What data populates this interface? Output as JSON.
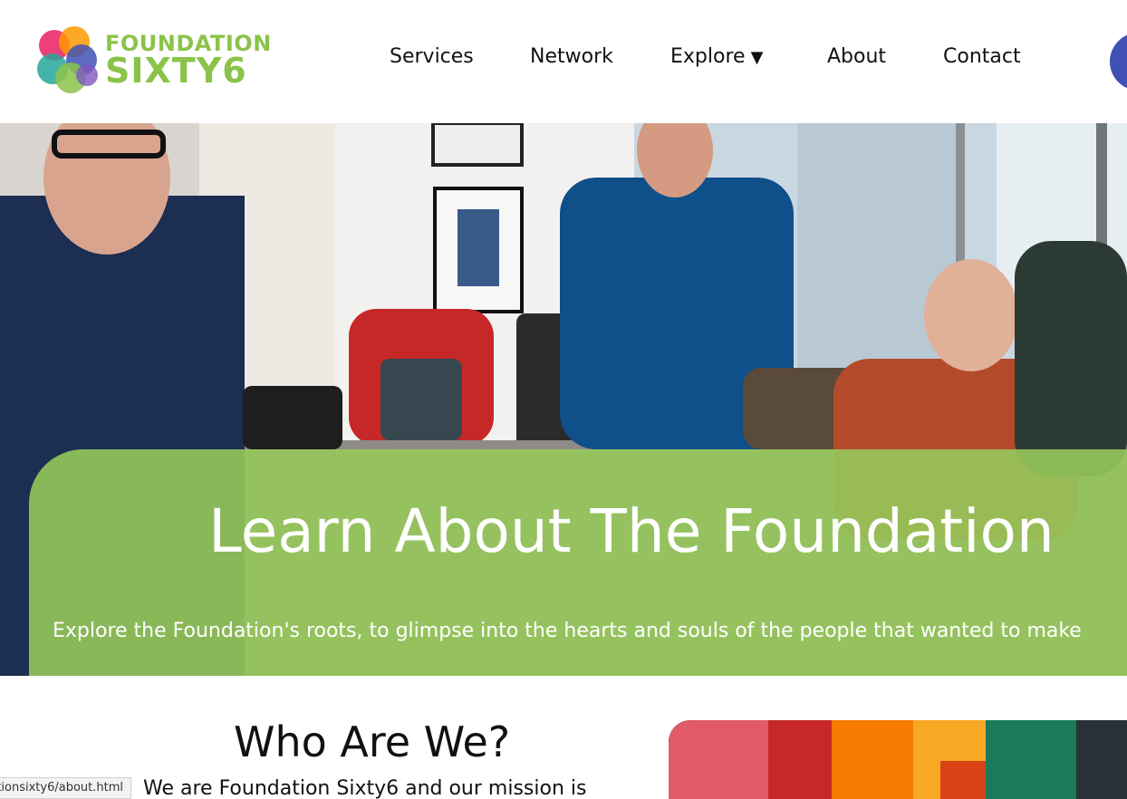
{
  "header": {
    "logo": {
      "line1": "FOUNDATION",
      "line2": "SIXTY6",
      "brand_color": "#8bc34a",
      "icon": "overlapping-circles-logo-icon"
    },
    "nav": [
      {
        "label": "Services"
      },
      {
        "label": "Network"
      },
      {
        "label": "Explore"
      },
      {
        "label": "About"
      },
      {
        "label": "Contact"
      }
    ],
    "dropdown_caret": "▼"
  },
  "hero": {
    "title": "Learn About The Foundation",
    "subtitle": "Explore the Foundation's roots, to glimpse into the hearts and souls of the people that wanted to make",
    "panel_color": "#96c85a"
  },
  "about": {
    "heading": "Who Are We?",
    "intro": "We are Foundation Sixty6 and our mission is"
  },
  "status_bar": {
    "url": "tionsixty6/about.html"
  }
}
